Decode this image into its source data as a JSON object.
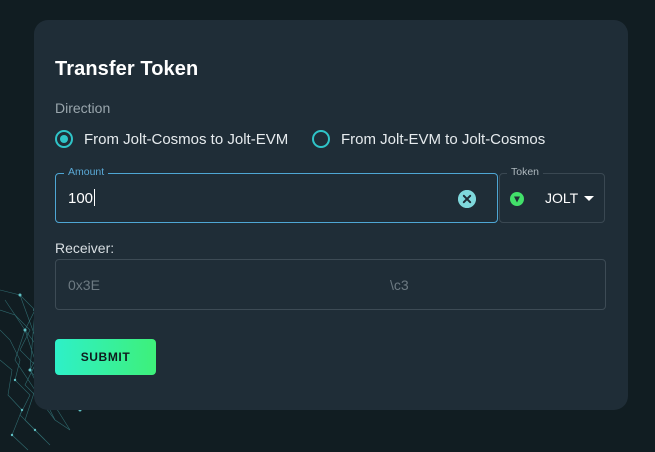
{
  "form": {
    "title": "Transfer Token",
    "direction_label": "Direction",
    "directions": [
      {
        "label": "From Jolt-Cosmos to Jolt-EVM",
        "selected": true
      },
      {
        "label": "From Jolt-EVM to Jolt-Cosmos",
        "selected": false
      }
    ],
    "amount": {
      "legend": "Amount",
      "value": "100"
    },
    "token": {
      "legend": "Token",
      "value": "JOLT",
      "icon": "jolt-token-icon"
    },
    "receiver": {
      "label": "Receiver:",
      "value_start": "0x3E",
      "value_end": "\\c3"
    },
    "submit_label": "SUBMIT"
  },
  "colors": {
    "background": "#111d22",
    "card": "#1f2d37",
    "accent": "#2fc4c8",
    "focus": "#4ea6d4",
    "submit_gradient": [
      "#2ef0c8",
      "#3ef07a"
    ]
  }
}
